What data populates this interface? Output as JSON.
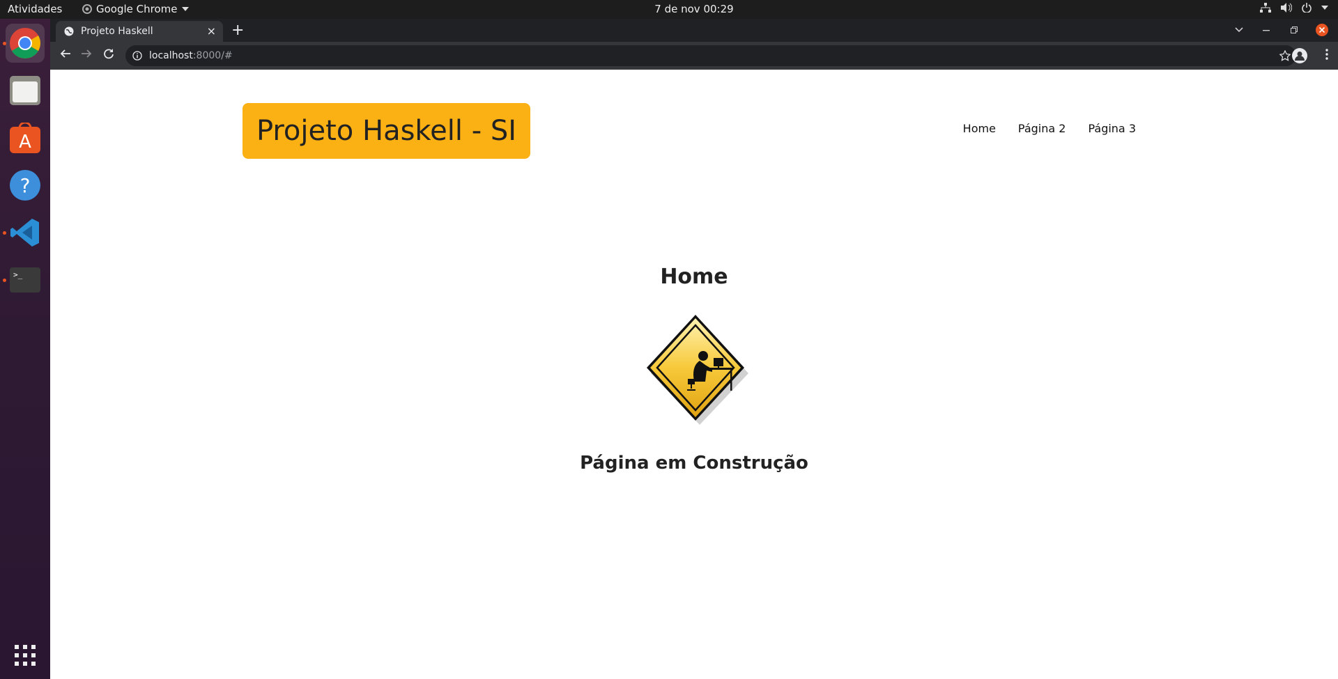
{
  "topbar": {
    "activities": "Atividades",
    "app_name": "Google Chrome",
    "clock": "7 de nov  00:29"
  },
  "dock": {
    "items": [
      "chrome-icon",
      "files-icon",
      "software-icon",
      "help-icon",
      "vscode-icon",
      "terminal-icon"
    ],
    "apps_grid": "apps-grid-icon"
  },
  "browser": {
    "tab_title": "Projeto Haskell",
    "tab_close": "×",
    "new_tab": "+",
    "url_host": "localhost",
    "url_rest": ":8000/#"
  },
  "site": {
    "brand": "Projeto Haskell - SI",
    "nav": [
      "Home",
      "Página 2",
      "Página 3"
    ],
    "heading": "Home",
    "subtitle": "Página em Construção"
  },
  "colors": {
    "brand_bg": "#fbb014",
    "dock_accent": "#e95420"
  }
}
